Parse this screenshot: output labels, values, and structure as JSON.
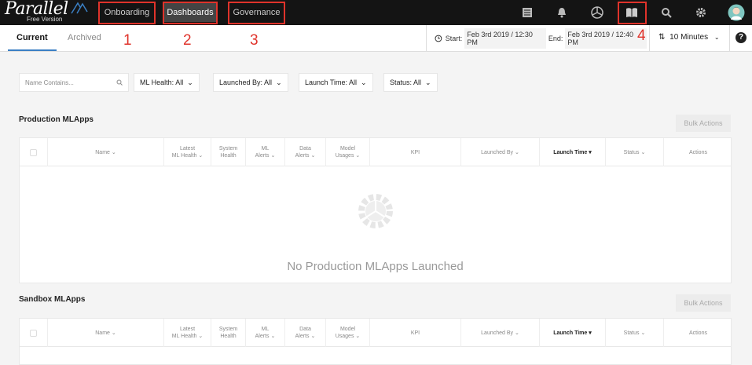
{
  "app": {
    "logo_text": "Parallel",
    "logo_sub": "Free Version"
  },
  "nav": {
    "items": [
      {
        "label": "Onboarding"
      },
      {
        "label": "Dashboards"
      },
      {
        "label": "Governance"
      }
    ]
  },
  "annotations": [
    "1",
    "2",
    "3",
    "4"
  ],
  "tabs": [
    {
      "label": "Current"
    },
    {
      "label": "Archived"
    }
  ],
  "time": {
    "start_label": "Start:",
    "start_value": "Feb 3rd 2019 / 12:30 PM",
    "end_label": "End:",
    "end_value": "Feb 3rd 2019 / 12:40 PM",
    "interval": "10 Minutes"
  },
  "filters": {
    "search_placeholder": "Name Contains...",
    "items": [
      {
        "label": "ML Health: All"
      },
      {
        "label": "Launched By: All"
      },
      {
        "label": "Launch Time: All"
      },
      {
        "label": "Status: All"
      }
    ]
  },
  "production": {
    "title": "Production MLApps",
    "bulk_label": "Bulk Actions",
    "empty_text": "No Production MLApps Launched"
  },
  "sandbox": {
    "title": "Sandbox MLApps",
    "bulk_label": "Bulk Actions"
  },
  "columns": [
    {
      "l1": "Name",
      "l2": ""
    },
    {
      "l1": "Latest",
      "l2": "ML Health"
    },
    {
      "l1": "System",
      "l2": "Health"
    },
    {
      "l1": "ML",
      "l2": "Alerts"
    },
    {
      "l1": "Data",
      "l2": "Alerts"
    },
    {
      "l1": "Model",
      "l2": "Usages"
    },
    {
      "l1": "KPI",
      "l2": ""
    },
    {
      "l1": "Launched By",
      "l2": ""
    },
    {
      "l1": "Launch Time",
      "l2": ""
    },
    {
      "l1": "Status",
      "l2": ""
    },
    {
      "l1": "Actions",
      "l2": ""
    }
  ],
  "icons": [
    "list-icon",
    "bell-icon",
    "aperture-icon",
    "book-icon",
    "search-icon",
    "gear-icon",
    "avatar"
  ],
  "colors": {
    "topbar": "#141414",
    "accent": "#3b7fc4",
    "annotation": "#e0332b"
  }
}
